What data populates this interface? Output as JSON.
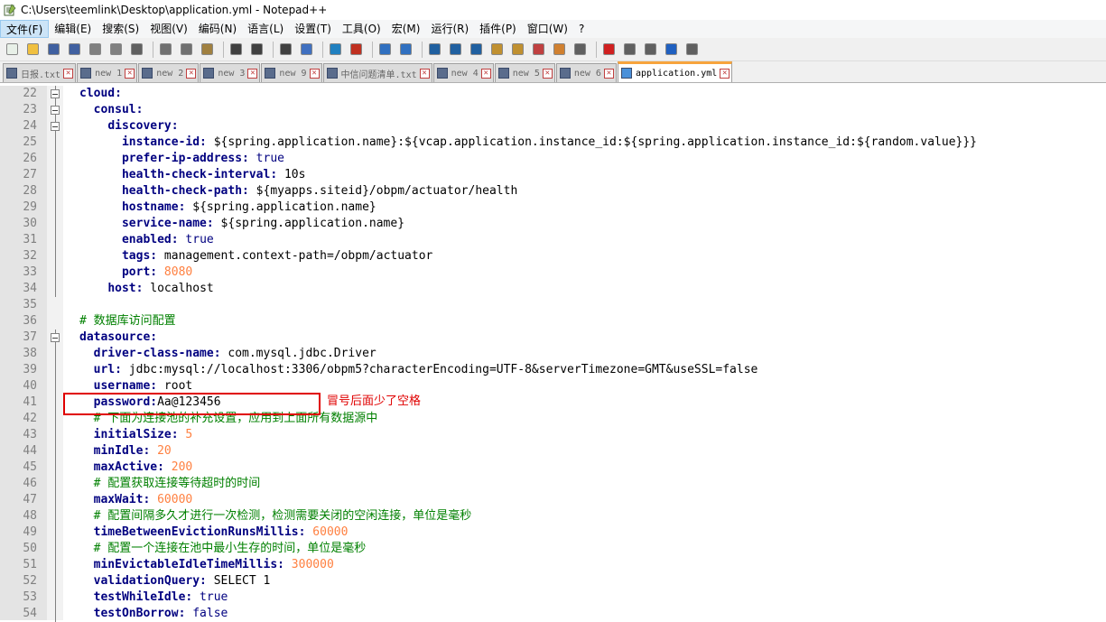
{
  "window": {
    "title": "C:\\Users\\teemlink\\Desktop\\application.yml - Notepad++"
  },
  "menu": [
    "文件(F)",
    "编辑(E)",
    "搜索(S)",
    "视图(V)",
    "编码(N)",
    "语言(L)",
    "设置(T)",
    "工具(O)",
    "宏(M)",
    "运行(R)",
    "插件(P)",
    "窗口(W)",
    "?"
  ],
  "tabs": [
    "日报.txt",
    "new 1",
    "new 2",
    "new 3",
    "new 9",
    "中信问题清单.txt",
    "new 4",
    "new 5",
    "new 6",
    "application.yml"
  ],
  "active_tab": "application.yml",
  "editor": {
    "lines": [
      {
        "n": "22",
        "indent": "",
        "key": "cloud:",
        "val": "",
        "vt": ""
      },
      {
        "n": "23",
        "indent": "  ",
        "key": "consul:",
        "val": "",
        "vt": ""
      },
      {
        "n": "24",
        "indent": "    ",
        "key": "discovery:",
        "val": "",
        "vt": ""
      },
      {
        "n": "25",
        "indent": "      ",
        "key": "instance-id:",
        "val": " ${spring.application.name}:${vcap.application.instance_id:${spring.application.instance_id:${random.value}}}",
        "vt": "v"
      },
      {
        "n": "26",
        "indent": "      ",
        "key": "prefer-ip-address:",
        "val": " true",
        "vt": "b"
      },
      {
        "n": "27",
        "indent": "      ",
        "key": "health-check-interval:",
        "val": " 10s",
        "vt": "v"
      },
      {
        "n": "28",
        "indent": "      ",
        "key": "health-check-path:",
        "val": " ${myapps.siteid}/obpm/actuator/health",
        "vt": "v"
      },
      {
        "n": "29",
        "indent": "      ",
        "key": "hostname:",
        "val": " ${spring.application.name}",
        "vt": "v"
      },
      {
        "n": "30",
        "indent": "      ",
        "key": "service-name:",
        "val": " ${spring.application.name}",
        "vt": "v"
      },
      {
        "n": "31",
        "indent": "      ",
        "key": "enabled:",
        "val": " true",
        "vt": "b"
      },
      {
        "n": "32",
        "indent": "      ",
        "key": "tags:",
        "val": " management.context-path=/obpm/actuator",
        "vt": "v"
      },
      {
        "n": "33",
        "indent": "      ",
        "key": "port:",
        "val": " 8080",
        "vt": "n"
      },
      {
        "n": "34",
        "indent": "    ",
        "key": "host:",
        "val": " localhost",
        "vt": "v"
      },
      {
        "n": "35",
        "indent": "",
        "key": "",
        "val": "",
        "vt": ""
      },
      {
        "n": "36",
        "indent": "",
        "key": "",
        "val": "# 数据库访问配置",
        "vt": "c"
      },
      {
        "n": "37",
        "indent": "",
        "key": "datasource:",
        "val": "",
        "vt": ""
      },
      {
        "n": "38",
        "indent": "  ",
        "key": "driver-class-name:",
        "val": " com.mysql.jdbc.Driver",
        "vt": "v"
      },
      {
        "n": "39",
        "indent": "  ",
        "key": "url:",
        "val": " jdbc:mysql://localhost:3306/obpm5?characterEncoding=UTF-8&serverTimezone=GMT&useSSL=false",
        "vt": "v"
      },
      {
        "n": "40",
        "indent": "  ",
        "key": "username:",
        "val": " root",
        "vt": "v"
      },
      {
        "n": "41",
        "indent": "  ",
        "key": "password:",
        "val": "Aa@123456",
        "vt": "v"
      },
      {
        "n": "42",
        "indent": "  ",
        "key": "",
        "val": "# 下面为连接池的补充设置，应用到上面所有数据源中",
        "vt": "c"
      },
      {
        "n": "43",
        "indent": "  ",
        "key": "initialSize:",
        "val": " 5",
        "vt": "n"
      },
      {
        "n": "44",
        "indent": "  ",
        "key": "minIdle:",
        "val": " 20",
        "vt": "n"
      },
      {
        "n": "45",
        "indent": "  ",
        "key": "maxActive:",
        "val": " 200",
        "vt": "n"
      },
      {
        "n": "46",
        "indent": "  ",
        "key": "",
        "val": "# 配置获取连接等待超时的时间",
        "vt": "c"
      },
      {
        "n": "47",
        "indent": "  ",
        "key": "maxWait:",
        "val": " 60000",
        "vt": "n"
      },
      {
        "n": "48",
        "indent": "  ",
        "key": "",
        "val": "# 配置间隔多久才进行一次检测，检测需要关闭的空闲连接，单位是毫秒",
        "vt": "c"
      },
      {
        "n": "49",
        "indent": "  ",
        "key": "timeBetweenEvictionRunsMillis:",
        "val": " 60000",
        "vt": "n"
      },
      {
        "n": "50",
        "indent": "  ",
        "key": "",
        "val": "# 配置一个连接在池中最小生存的时间，单位是毫秒",
        "vt": "c"
      },
      {
        "n": "51",
        "indent": "  ",
        "key": "minEvictableIdleTimeMillis:",
        "val": " 300000",
        "vt": "n"
      },
      {
        "n": "52",
        "indent": "  ",
        "key": "validationQuery:",
        "val": " SELECT 1",
        "vt": "v"
      },
      {
        "n": "53",
        "indent": "  ",
        "key": "testWhileIdle:",
        "val": " true",
        "vt": "b"
      },
      {
        "n": "54",
        "indent": "  ",
        "key": "testOnBorrow:",
        "val": " false",
        "vt": "b"
      }
    ]
  },
  "annotation": {
    "note": "冒号后面少了空格"
  },
  "colors": {
    "key": "#000080",
    "number": "#ff8040",
    "comment": "#008000",
    "highlight": "#e00000",
    "active_tab": "#f7a43d"
  }
}
